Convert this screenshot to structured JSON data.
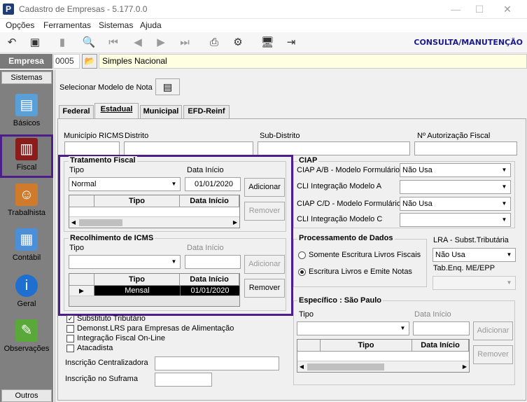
{
  "window": {
    "title": "Cadastro de Empresas - 5.177.0.0",
    "app_icon": "P"
  },
  "menu": [
    "Opções",
    "Ferramentas",
    "Sistemas",
    "Ajuda"
  ],
  "toolbar": {
    "mode_label": "CONSULTA/MANUTENÇÃO"
  },
  "empresa": {
    "label": "Empresa",
    "code": "0005",
    "name": "Simples Nacional"
  },
  "sidebar": {
    "header": "Sistemas",
    "footer": "Outros",
    "items": [
      {
        "label": "Básicos",
        "icon": "notebook-icon"
      },
      {
        "label": "Fiscal",
        "icon": "fiscal-book-icon"
      },
      {
        "label": "Trabalhista",
        "icon": "worker-icon"
      },
      {
        "label": "Contábil",
        "icon": "calculator-icon"
      },
      {
        "label": "Geral",
        "icon": "info-icon"
      },
      {
        "label": "Observações",
        "icon": "notes-icon"
      }
    ]
  },
  "modelo_nota": {
    "label": "Selecionar Modelo de Nota"
  },
  "tabs": [
    "Federal",
    "Estadual",
    "Municipal",
    "EFD-Reinf"
  ],
  "fields": {
    "municipio_ricms": "Município RICMS",
    "distrito": "Distrito",
    "subdistrito": "Sub-Distrito",
    "autorizacao": "Nº Autorização Fiscal"
  },
  "tratamento": {
    "title": "Tratamento Fiscal",
    "tipo_label": "Tipo",
    "tipo_value": "Normal",
    "data_label": "Data Início",
    "data_value": "01/01/2020",
    "add": "Adicionar",
    "remove": "Remover",
    "col_tipo": "Tipo",
    "col_data": "Data Início"
  },
  "recolhimento": {
    "title": "Recolhimento de ICMS",
    "tipo_label": "Tipo",
    "data_label": "Data Início",
    "add": "Adicionar",
    "remove": "Remover",
    "col_tipo": "Tipo",
    "col_data": "Data Início",
    "row_tipo": "Mensal",
    "row_data": "01/01/2020"
  },
  "ciap": {
    "title": "CIAP",
    "ab_label": "CIAP  A/B - Modelo Formulário",
    "ab_value": "Não Usa",
    "cli_a_label": "CLI Integração Modelo A",
    "cd_label": "CIAP C/D - Modelo Formulário",
    "cd_value": "Não Usa",
    "cli_c_label": "CLI Integração Modelo C"
  },
  "processamento": {
    "title": "Processamento de Dados",
    "opt1": "Somente Escritura Livros Fiscais",
    "opt2": "Escritura Livros e Emite Notas",
    "selected": 2
  },
  "lra": {
    "label": "LRA - Subst.Tributária",
    "value": "Não Usa",
    "tab_label": "Tab.Enq. ME/EPP"
  },
  "checks": [
    {
      "label": "Substituto Tributário",
      "checked": true
    },
    {
      "label": "Demonst.LRS para Empresas de Alimentação",
      "checked": false
    },
    {
      "label": "Integração Fiscal On-Line",
      "checked": false
    },
    {
      "label": "Atacadista",
      "checked": false
    }
  ],
  "inscricao_centralizadora": "Inscrição Centralizadora",
  "inscricao_suframa": "Inscrição no Suframa",
  "especifico": {
    "title": "Específico : São Paulo",
    "tipo_label": "Tipo",
    "data_label": "Data Início",
    "add": "Adicionar",
    "remove": "Remover",
    "col_tipo": "Tipo",
    "col_data": "Data Início"
  },
  "colors": {
    "highlight": "#4b1e8a",
    "selection_row": "#000000",
    "empresa_bg": "#ffffe1"
  }
}
